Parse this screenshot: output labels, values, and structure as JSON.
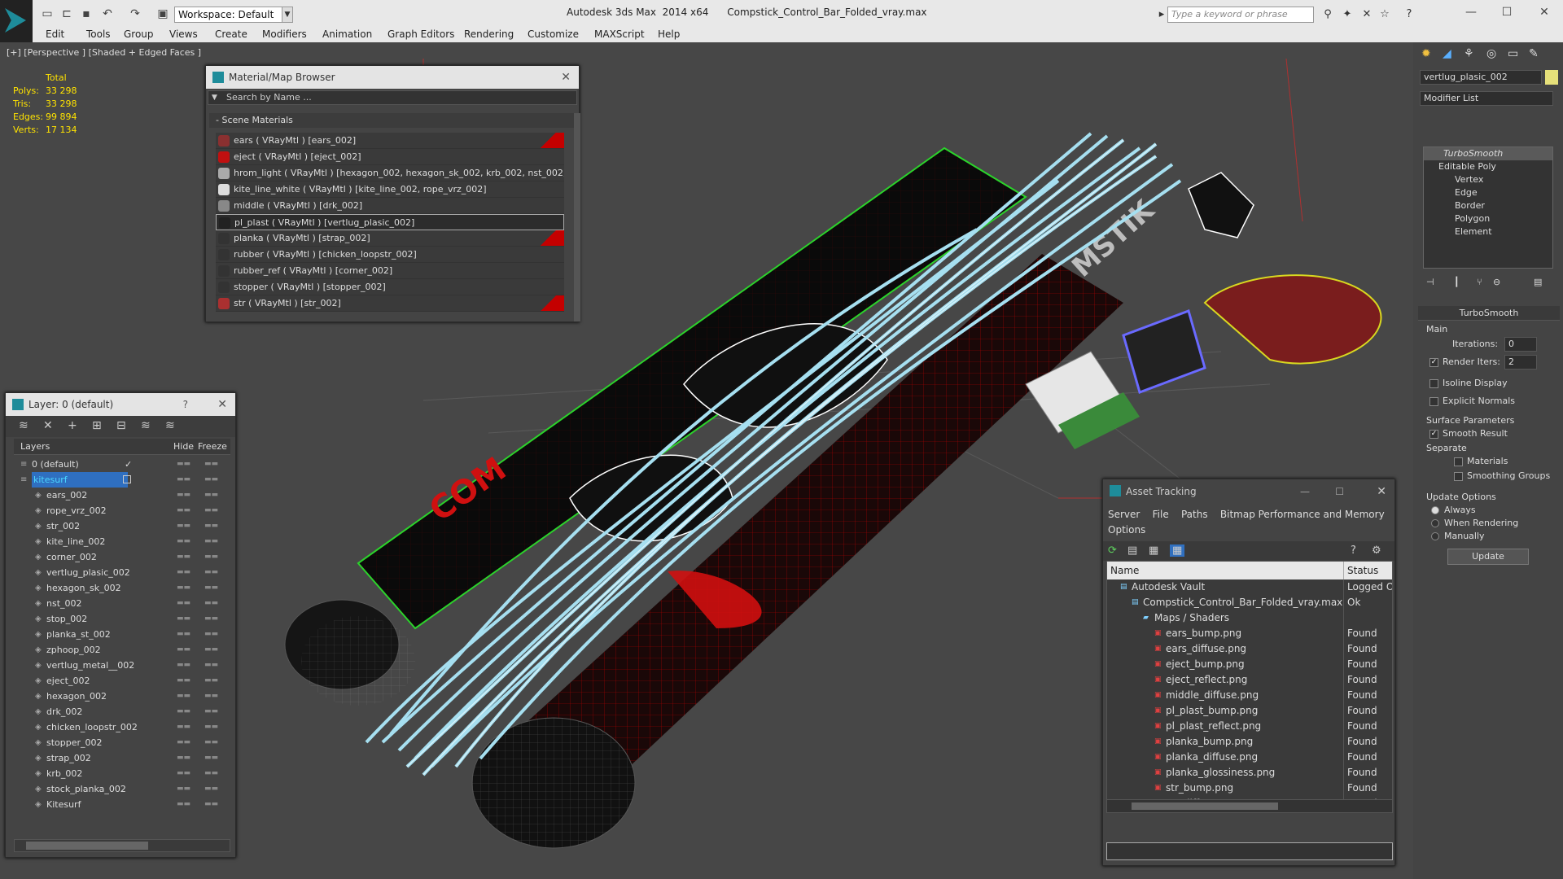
{
  "titlebar": {
    "workspace": "Workspace: Default",
    "app_name": "Autodesk 3ds Max  2014 x64",
    "file_name": "Compstick_Control_Bar_Folded_vray.max",
    "search_placeholder": "Type a keyword or phrase"
  },
  "menu": [
    "Edit",
    "Tools",
    "Group",
    "Views",
    "Create",
    "Modifiers",
    "Animation",
    "Graph Editors",
    "Rendering",
    "Customize",
    "MAXScript",
    "Help"
  ],
  "viewport": {
    "label": "[+] [Perspective ] [Shaded + Edged Faces ]",
    "stats": {
      "header": "Total",
      "rows": [
        {
          "k": "Polys:",
          "v": "33 298"
        },
        {
          "k": "Tris:",
          "v": "33 298"
        },
        {
          "k": "Edges:",
          "v": "99 894"
        },
        {
          "k": "Verts:",
          "v": "17 134"
        }
      ]
    }
  },
  "material_browser": {
    "title": "Material/Map Browser",
    "search": "Search by Name ...",
    "section": "- Scene Materials",
    "items": [
      {
        "label": "ears  ( VRayMtl ) [ears_002]",
        "color": "#8a3030",
        "flag": true
      },
      {
        "label": "eject  ( VRayMtl ) [eject_002]",
        "color": "#c01010",
        "flag": false
      },
      {
        "label": "hrom_light  ( VRayMtl ) [hexagon_002, hexagon_sk_002, krb_002, nst_002,...",
        "color": "#aaaaaa",
        "flag": false
      },
      {
        "label": "kite_line_white  ( VRayMtl ) [kite_line_002, rope_vrz_002]",
        "color": "#dddddd",
        "flag": false
      },
      {
        "label": "middle  ( VRayMtl ) [drk_002]",
        "color": "#888888",
        "flag": false
      },
      {
        "label": "pl_plast  ( VRayMtl ) [vertlug_plasic_002]",
        "color": "#222222",
        "flag": false,
        "selected": true
      },
      {
        "label": "planka  ( VRayMtl ) [strap_002]",
        "color": "#333333",
        "flag": true
      },
      {
        "label": "rubber  ( VRayMtl ) [chicken_loopstr_002]",
        "color": "#333333",
        "flag": false
      },
      {
        "label": "rubber_ref  ( VRayMtl ) [corner_002]",
        "color": "#333333",
        "flag": false
      },
      {
        "label": "stopper  ( VRayMtl ) [stopper_002]",
        "color": "#333333",
        "flag": false
      },
      {
        "label": "str  ( VRayMtl ) [str_002]",
        "color": "#aa3030",
        "flag": true
      }
    ]
  },
  "layer_panel": {
    "title": "Layer: 0 (default)",
    "help": "?",
    "columns": {
      "layers": "Layers",
      "hide": "Hide",
      "freeze": "Freeze"
    },
    "rows": [
      {
        "label": "0 (default)",
        "level": 0,
        "check": true
      },
      {
        "label": "kitesurf",
        "level": 0,
        "selected": true
      },
      {
        "label": "ears_002",
        "level": 1
      },
      {
        "label": "rope_vrz_002",
        "level": 1
      },
      {
        "label": "str_002",
        "level": 1
      },
      {
        "label": "kite_line_002",
        "level": 1
      },
      {
        "label": "corner_002",
        "level": 1
      },
      {
        "label": "vertlug_plasic_002",
        "level": 1
      },
      {
        "label": "hexagon_sk_002",
        "level": 1
      },
      {
        "label": "nst_002",
        "level": 1
      },
      {
        "label": "stop_002",
        "level": 1
      },
      {
        "label": "planka_st_002",
        "level": 1
      },
      {
        "label": "zphoop_002",
        "level": 1
      },
      {
        "label": "vertlug_metal__002",
        "level": 1
      },
      {
        "label": "eject_002",
        "level": 1
      },
      {
        "label": "hexagon_002",
        "level": 1
      },
      {
        "label": "drk_002",
        "level": 1
      },
      {
        "label": "chicken_loopstr_002",
        "level": 1
      },
      {
        "label": "stopper_002",
        "level": 1
      },
      {
        "label": "strap_002",
        "level": 1
      },
      {
        "label": "krb_002",
        "level": 1
      },
      {
        "label": "stock_planka_002",
        "level": 1
      },
      {
        "label": "Kitesurf",
        "level": 1
      }
    ]
  },
  "asset_tracking": {
    "title": "Asset Tracking",
    "menu": [
      "Server",
      "File",
      "Paths",
      "Bitmap Performance and Memory",
      "Options"
    ],
    "columns": {
      "name": "Name",
      "status": "Status"
    },
    "rows": [
      {
        "name": "Autodesk Vault",
        "status": "Logged Ou",
        "indent": 1
      },
      {
        "name": "Compstick_Control_Bar_Folded_vray.max",
        "status": "Ok",
        "indent": 2
      },
      {
        "name": "Maps / Shaders",
        "status": "",
        "indent": 3
      },
      {
        "name": "ears_bump.png",
        "status": "Found",
        "indent": 4
      },
      {
        "name": "ears_diffuse.png",
        "status": "Found",
        "indent": 4
      },
      {
        "name": "eject_bump.png",
        "status": "Found",
        "indent": 4
      },
      {
        "name": "eject_reflect.png",
        "status": "Found",
        "indent": 4
      },
      {
        "name": "middle_diffuse.png",
        "status": "Found",
        "indent": 4
      },
      {
        "name": "pl_plast_bump.png",
        "status": "Found",
        "indent": 4
      },
      {
        "name": "pl_plast_reflect.png",
        "status": "Found",
        "indent": 4
      },
      {
        "name": "planka_bump.png",
        "status": "Found",
        "indent": 4
      },
      {
        "name": "planka_diffuse.png",
        "status": "Found",
        "indent": 4
      },
      {
        "name": "planka_glossiness.png",
        "status": "Found",
        "indent": 4
      },
      {
        "name": "str_bump.png",
        "status": "Found",
        "indent": 4
      },
      {
        "name": "str_diffuse.png",
        "status": "Found",
        "indent": 4
      }
    ]
  },
  "command_panel": {
    "object_name": "vertlug_plasic_002",
    "modifier_list": "Modifier List",
    "stack": [
      "TurboSmooth",
      "Editable Poly",
      "Vertex",
      "Edge",
      "Border",
      "Polygon",
      "Element"
    ],
    "rollout": "TurboSmooth",
    "main": "Main",
    "iterations_label": "Iterations:",
    "iterations": "0",
    "render_iters_label": "Render Iters:",
    "render_iters": "2",
    "isoline": "Isoline Display",
    "explicit": "Explicit Normals",
    "surface": "Surface Parameters",
    "smooth_result": "Smooth Result",
    "separate": "Separate",
    "materials": "Materials",
    "smoothing_groups": "Smoothing Groups",
    "update_options": "Update Options",
    "always": "Always",
    "when_rendering": "When Rendering",
    "manually": "Manually",
    "update": "Update"
  }
}
